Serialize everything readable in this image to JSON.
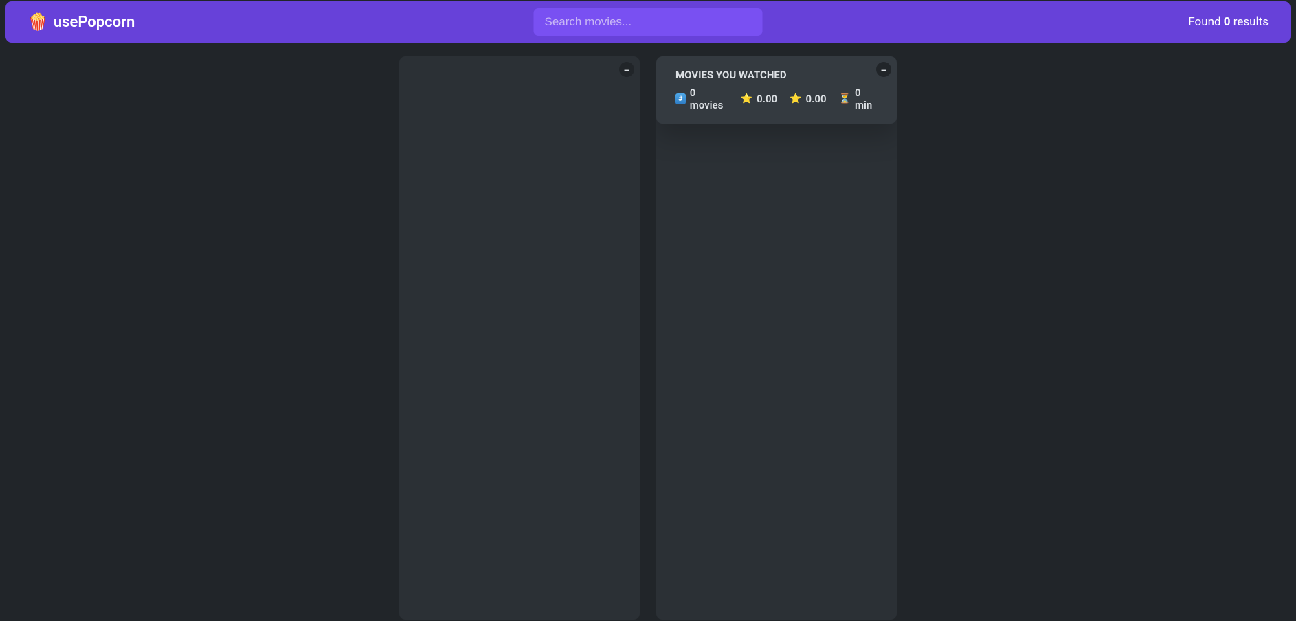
{
  "navbar": {
    "logo_emoji": "🍿",
    "logo_text": "usePopcorn",
    "search_placeholder": "Search movies...",
    "results_prefix": "Found ",
    "results_count": "0",
    "results_suffix": " results"
  },
  "box_left": {
    "toggle_label": "–"
  },
  "box_right": {
    "toggle_label": "–",
    "summary": {
      "title": "MOVIES YOU WATCHED",
      "stats": {
        "count_icon": "#",
        "count_value": "0 movies",
        "imdb_rating": "0.00",
        "user_rating": "0.00",
        "runtime": "0 min"
      }
    }
  }
}
